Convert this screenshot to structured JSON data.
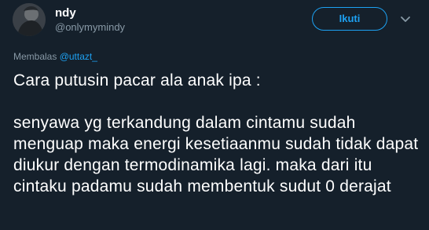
{
  "user": {
    "display_name": "ndy",
    "handle": "@onlymymindy",
    "avatar_icon": "profile-photo"
  },
  "follow_button": {
    "label": "Ikuti"
  },
  "menu": {
    "icon": "chevron-down-icon"
  },
  "reply": {
    "prefix": "Membalas",
    "mention": "@uttazt_"
  },
  "tweet": {
    "text": "Cara putusin pacar ala anak ipa :\n\nsenyawa yg terkandung dalam cintamu sudah menguap maka energi kesetiaanmu sudah tidak dapat diukur dengan termodinamika lagi. maka dari itu cintaku padamu sudah membentuk sudut 0 derajat"
  },
  "colors": {
    "background": "#15202b",
    "accent": "#1da1f2",
    "muted": "#8899a6",
    "text": "#ffffff"
  }
}
